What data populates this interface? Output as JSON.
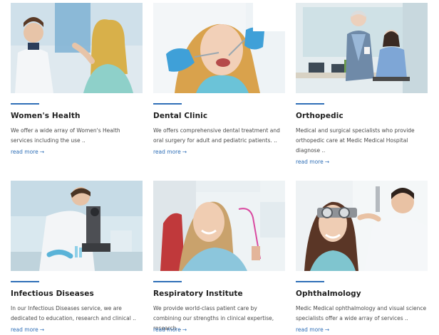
{
  "cards": [
    {
      "title": "Women's Health",
      "description": "We offer a wide array of Women's Health services including the use ..",
      "read_more": "read more",
      "arrow": "→",
      "image": "doctor-examining-woman-photo"
    },
    {
      "title": "Dental Clinic",
      "description": "We offers comprehensive dental treatment and oral surgery for adult and pediatric patients. ..",
      "read_more": "read more",
      "arrow": "→",
      "image": "dentist-patient-photo"
    },
    {
      "title": "Orthopedic",
      "description": "Medical and surgical specialists who provide orthopedic care at Medic Medical Hospital diagnose ..",
      "read_more": "read more",
      "arrow": "→",
      "image": "office-consultation-photo"
    },
    {
      "title": "Infectious Diseases",
      "description": "In our Infectious Diseases service, we are dedicated to education, research and clinical ..",
      "read_more": "read more",
      "arrow": "→",
      "image": "lab-microscope-photo"
    },
    {
      "title": "Respiratory Institute",
      "description": "We provide world-class patient care by combining our strengths in clinical expertise, research ..",
      "read_more": "read more",
      "arrow": "→",
      "image": "dental-chair-patient-photo"
    },
    {
      "title": "Ophthalmology",
      "description": "Medic Medical ophthalmology and visual science specialists offer a wide array of services ..",
      "read_more": "read more",
      "arrow": "→",
      "image": "eye-exam-photo"
    }
  ],
  "colors": {
    "accent": "#2f6fb7",
    "title": "#1f1f1f",
    "body_text": "#4a4a4a"
  }
}
